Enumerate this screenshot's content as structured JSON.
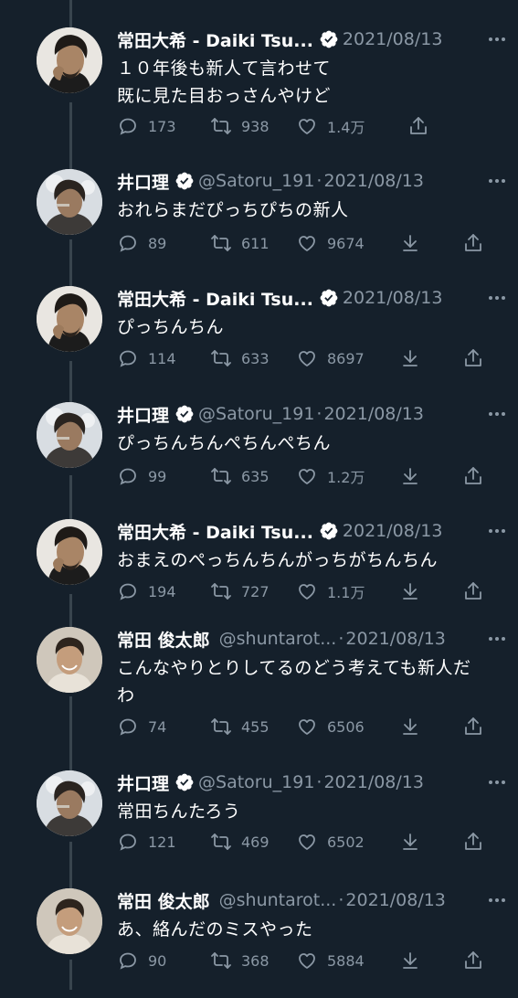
{
  "colors": {
    "background": "#15202b",
    "muted": "#8b98a5",
    "verified": "#ffffff",
    "thread_line": "#38444d"
  },
  "tweets": [
    {
      "name": "常田大希 - Daiki Tsu...",
      "handle": "",
      "separator": "",
      "date": "2021/08/13",
      "verified": true,
      "text": [
        "１０年後も新人て言わせて",
        "既に見た目おっさんやけど"
      ],
      "reply": "173",
      "retweet": "938",
      "like": "1.4万",
      "avatar": "daiki",
      "download": false
    },
    {
      "name": "井口理",
      "handle": "@Satoru_191",
      "separator": "·",
      "date": "2021/08/13",
      "verified": true,
      "text": [
        "おれらまだぴっちぴちの新人"
      ],
      "reply": "89",
      "retweet": "611",
      "like": "9674",
      "avatar": "satoru",
      "download": true
    },
    {
      "name": "常田大希 - Daiki Tsu...",
      "handle": "",
      "separator": "",
      "date": "2021/08/13",
      "verified": true,
      "text": [
        "ぴっちんちん"
      ],
      "reply": "114",
      "retweet": "633",
      "like": "8697",
      "avatar": "daiki",
      "download": true
    },
    {
      "name": "井口理",
      "handle": "@Satoru_191",
      "separator": "·",
      "date": "2021/08/13",
      "verified": true,
      "text": [
        "ぴっちんちんぺちんぺちん"
      ],
      "reply": "99",
      "retweet": "635",
      "like": "1.2万",
      "avatar": "satoru",
      "download": true
    },
    {
      "name": "常田大希 - Daiki Tsu...",
      "handle": "",
      "separator": "",
      "date": "2021/08/13",
      "verified": true,
      "text": [
        "おまえのぺっちんちんがっちがちんちん"
      ],
      "reply": "194",
      "retweet": "727",
      "like": "1.1万",
      "avatar": "daiki",
      "download": true
    },
    {
      "name": "常田 俊太郎",
      "handle": "@shuntarot...",
      "separator": "·",
      "date": "2021/08/13",
      "verified": false,
      "text": [
        "こんなやりとりしてるのどう考えても新人だ",
        "わ"
      ],
      "reply": "74",
      "retweet": "455",
      "like": "6506",
      "avatar": "shuntaro",
      "download": true
    },
    {
      "name": "井口理",
      "handle": "@Satoru_191",
      "separator": "·",
      "date": "2021/08/13",
      "verified": true,
      "text": [
        "常田ちんたろう"
      ],
      "reply": "121",
      "retweet": "469",
      "like": "6502",
      "avatar": "satoru",
      "download": true
    },
    {
      "name": "常田 俊太郎",
      "handle": "@shuntarot...",
      "separator": "·",
      "date": "2021/08/13",
      "verified": false,
      "text": [
        "あ、絡んだのミスやった"
      ],
      "reply": "90",
      "retweet": "368",
      "like": "5884",
      "avatar": "shuntaro",
      "download": true
    }
  ]
}
